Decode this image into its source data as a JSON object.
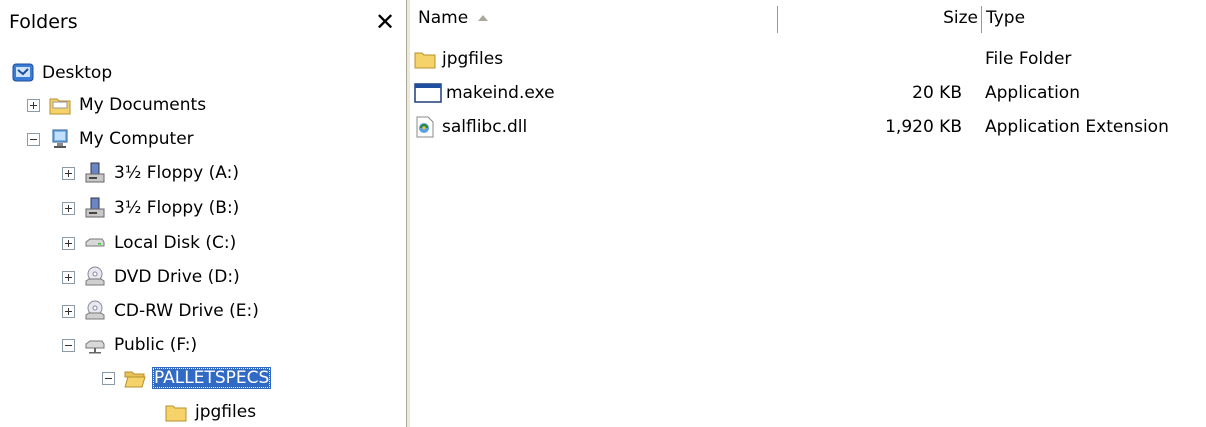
{
  "folders_pane": {
    "title": "Folders",
    "close_symbol": "✕",
    "tree": [
      {
        "label": "Desktop",
        "icon": "desktop-icon",
        "expander": "none"
      },
      {
        "label": "My Documents",
        "icon": "folder-icon",
        "expander": "plus"
      },
      {
        "label": "My Computer",
        "icon": "computer-icon",
        "expander": "minus"
      },
      {
        "label": "3½ Floppy (A:)",
        "icon": "floppy-drive-icon",
        "expander": "plus"
      },
      {
        "label": "3½ Floppy (B:)",
        "icon": "floppy-drive-icon",
        "expander": "plus"
      },
      {
        "label": "Local Disk (C:)",
        "icon": "hard-disk-icon",
        "expander": "plus"
      },
      {
        "label": "DVD Drive (D:)",
        "icon": "dvd-drive-icon",
        "expander": "plus"
      },
      {
        "label": "CD-RW Drive (E:)",
        "icon": "cd-drive-icon",
        "expander": "plus"
      },
      {
        "label": "Public (F:)",
        "icon": "network-drive-icon",
        "expander": "minus"
      },
      {
        "label": "PALLETSPECS",
        "icon": "open-folder-icon",
        "expander": "minus",
        "selected": true
      },
      {
        "label": "jpgfiles",
        "icon": "folder-icon",
        "expander": "none"
      }
    ]
  },
  "file_list": {
    "columns": {
      "name": "Name",
      "size": "Size",
      "type": "Type"
    },
    "sorted_by": "Name",
    "rows": [
      {
        "name": "jpgfiles",
        "size": "",
        "type": "File Folder",
        "icon": "folder-icon"
      },
      {
        "name": "makeind.exe",
        "size": "20 KB",
        "type": "Application",
        "icon": "application-icon"
      },
      {
        "name": "salflibc.dll",
        "size": "1,920 KB",
        "type": "Application Extension",
        "icon": "dll-icon"
      }
    ]
  },
  "colors": {
    "selection": "#316ac5",
    "folder": "#f5d36a",
    "splitter": "#ece9d8"
  }
}
